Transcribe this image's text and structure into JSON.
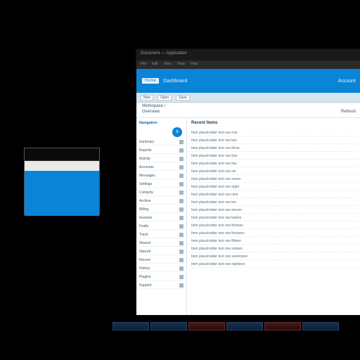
{
  "left_window": {
    "title": ""
  },
  "main": {
    "titlebar": "Document — Application",
    "ribbon": [
      "File",
      "Edit",
      "View",
      "Tools",
      "Help"
    ],
    "banner": {
      "tag": "Home",
      "label": "Dashboard",
      "right": "Account"
    },
    "toolbar": [
      "New",
      "Open",
      "Save"
    ],
    "subnav": {
      "line1": "Workspace /",
      "line2_left": "Overview",
      "line2_right": "Refresh"
    },
    "nav": {
      "heading": "Navigation",
      "badge": "8",
      "items": [
        "Summary",
        "Reports",
        "Activity",
        "Accounts",
        "Messages",
        "Settings",
        "Contacts",
        "Archive",
        "Billing",
        "Invoices",
        "Drafts",
        "Trash",
        "Shared",
        "Starred",
        "Recent",
        "History",
        "Plugins",
        "Support"
      ]
    },
    "list": {
      "heading": "Recent Items",
      "rows": [
        "Item placeholder text row one",
        "Item placeholder text row two",
        "Item placeholder text row three",
        "Item placeholder text row four",
        "Item placeholder text row five",
        "Item placeholder text row six",
        "Item placeholder text row seven",
        "Item placeholder text row eight",
        "Item placeholder text row nine",
        "Item placeholder text row ten",
        "Item placeholder text row eleven",
        "Item placeholder text row twelve",
        "Item placeholder text row thirteen",
        "Item placeholder text row fourteen",
        "Item placeholder text row fifteen",
        "Item placeholder text row sixteen",
        "Item placeholder text row seventeen",
        "Item placeholder text row eighteen"
      ]
    }
  }
}
